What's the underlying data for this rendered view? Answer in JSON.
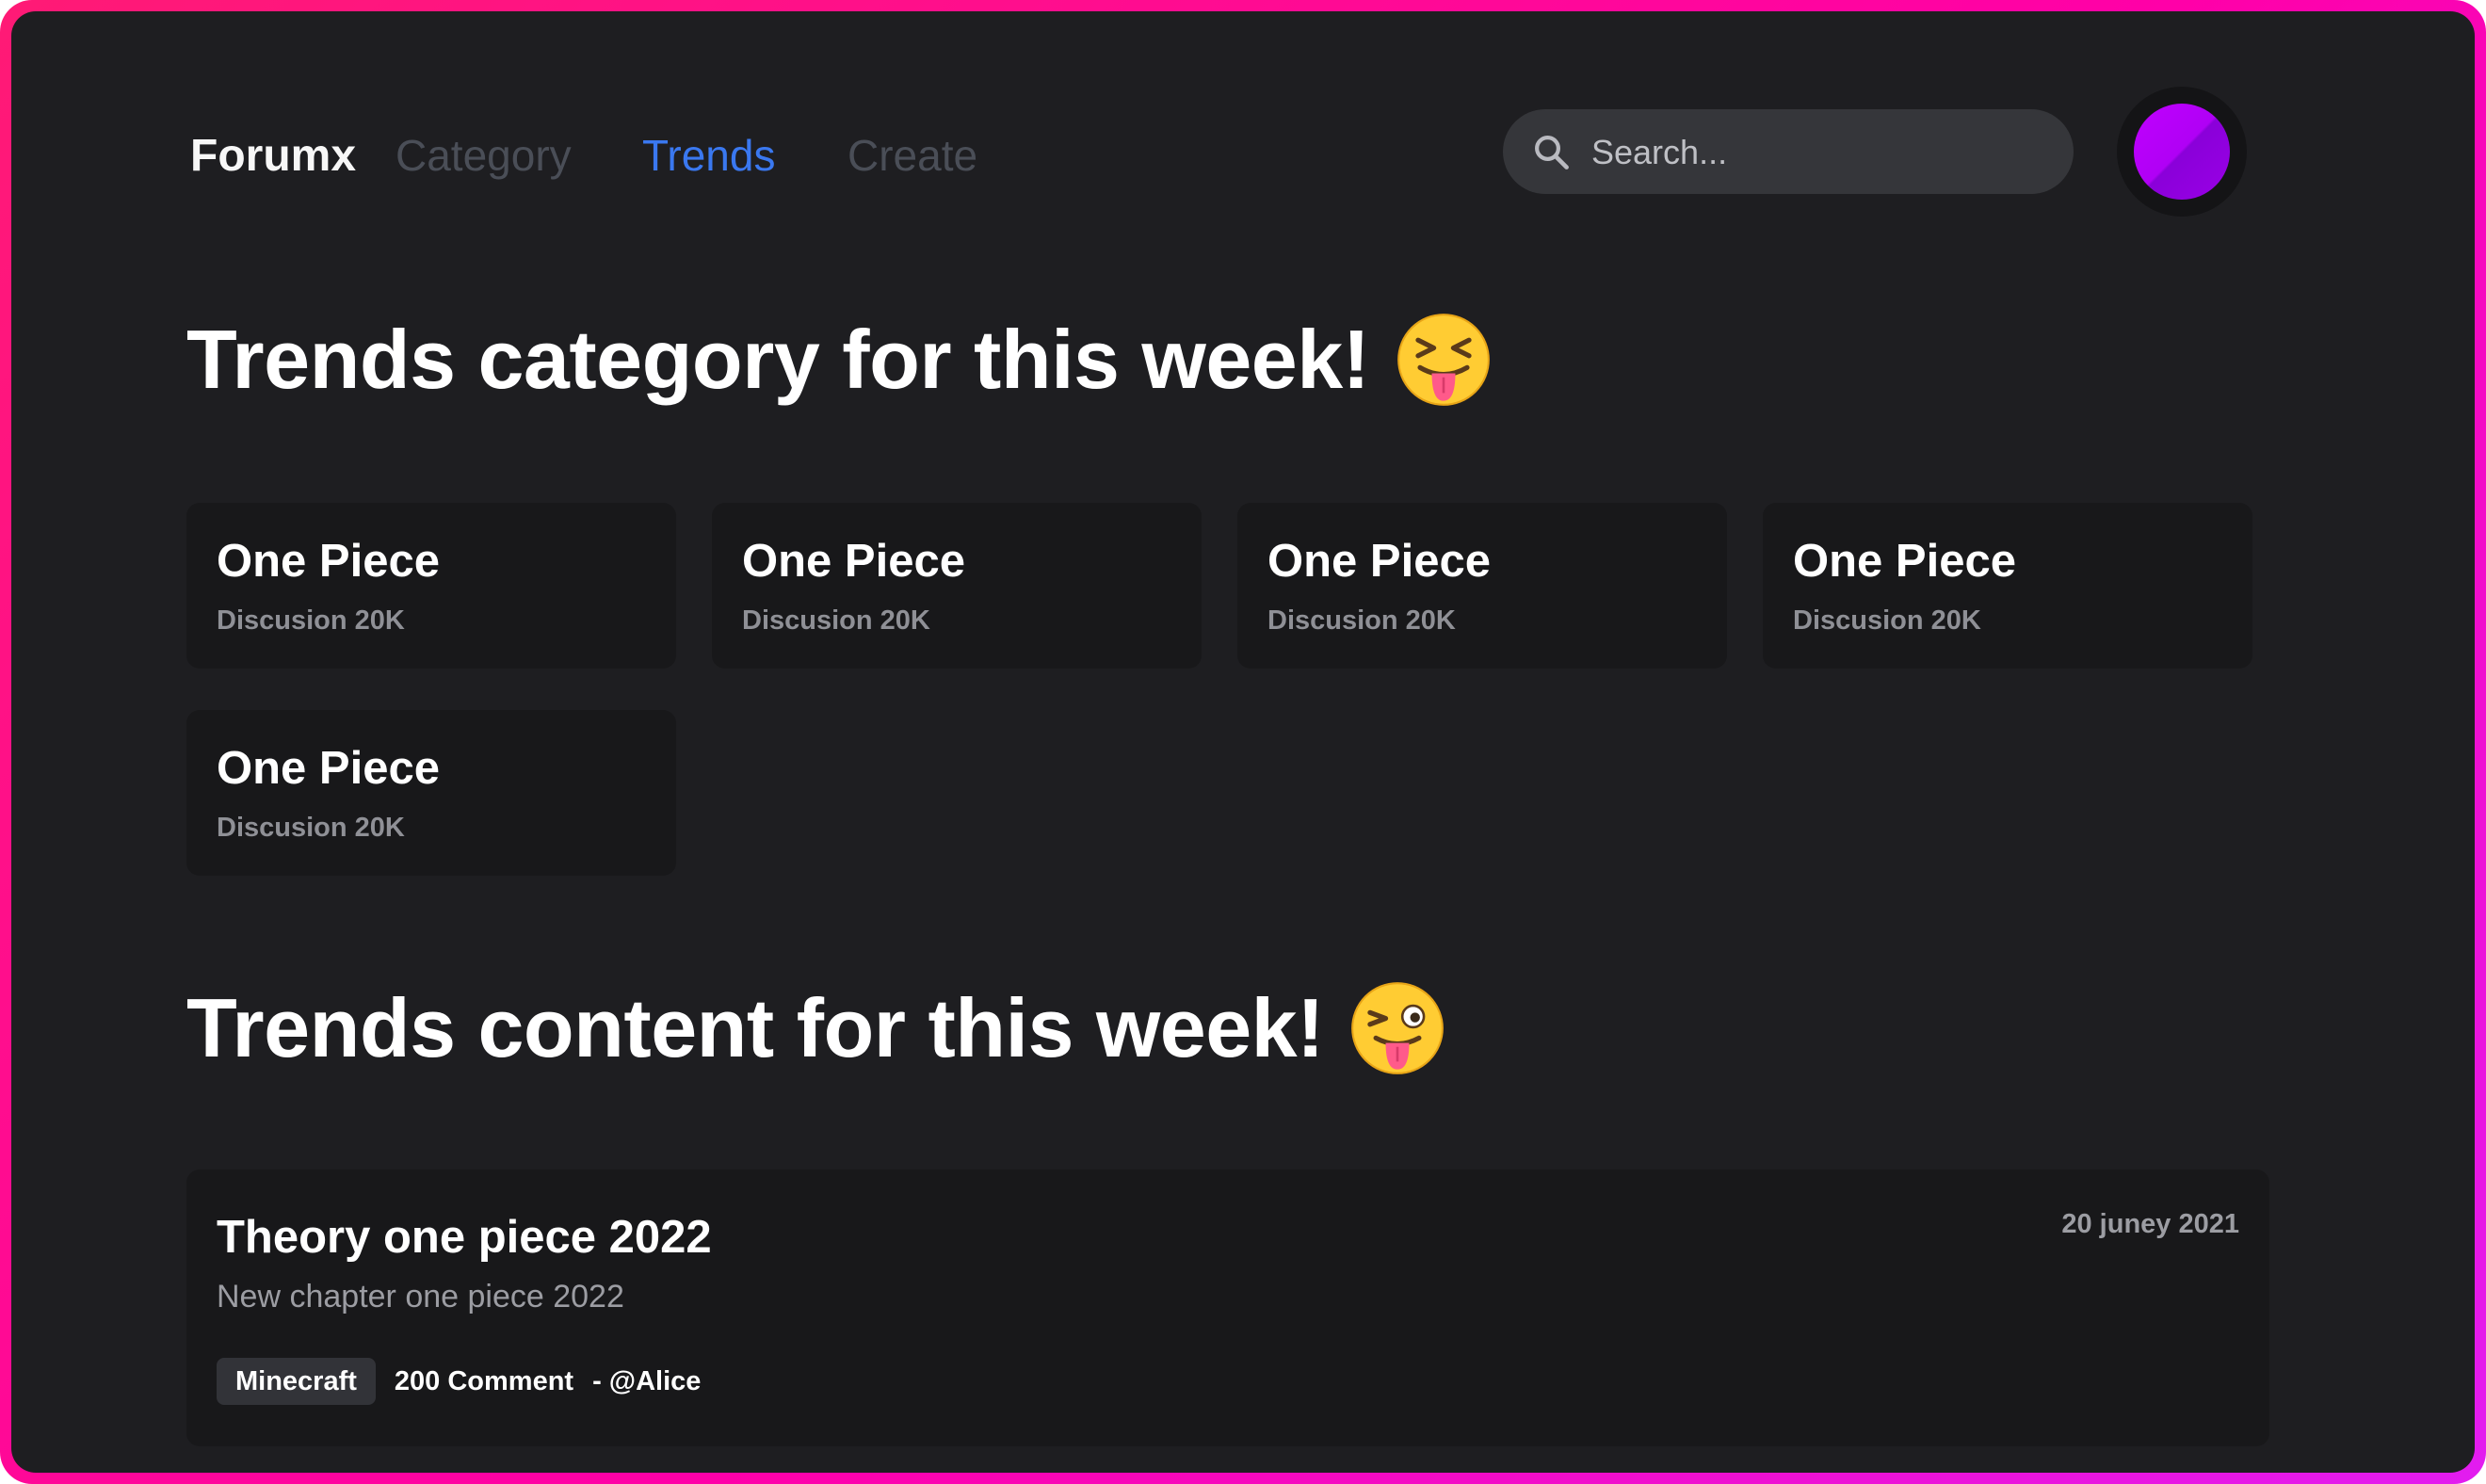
{
  "nav": {
    "brand": "Forumx",
    "links": [
      {
        "label": "Category",
        "active": false
      },
      {
        "label": "Trends",
        "active": true
      },
      {
        "label": "Create",
        "active": false
      }
    ],
    "search_placeholder": "Search...",
    "icons": {
      "search": "search-icon",
      "avatar": "user-avatar"
    }
  },
  "sections": {
    "categories_title": "Trends category for this week!",
    "categories_emoji": "squinting-face-with-tongue",
    "content_title": "Trends content for this week!",
    "content_emoji": "winking-face-with-tongue"
  },
  "categories": [
    {
      "title": "One Piece",
      "subtitle": "Discusion 20K"
    },
    {
      "title": "One Piece",
      "subtitle": "Discusion 20K"
    },
    {
      "title": "One Piece",
      "subtitle": "Discusion 20K"
    },
    {
      "title": "One Piece",
      "subtitle": "Discusion 20K"
    },
    {
      "title": "One Piece",
      "subtitle": "Discusion 20K"
    }
  ],
  "posts": [
    {
      "title": "Theory one piece 2022",
      "subtitle": "New chapter one piece 2022",
      "date": "20 juney 2021",
      "tag": "Minecraft",
      "comments": "200 Comment",
      "author": "- @Alice"
    }
  ],
  "colors": {
    "background": "#1e1e21",
    "card": "#18181a",
    "accent": "#3a78f0",
    "border_gradient_start": "#ff1a75",
    "border_gradient_end": "#e21cf0",
    "avatar": "#b000f5"
  }
}
